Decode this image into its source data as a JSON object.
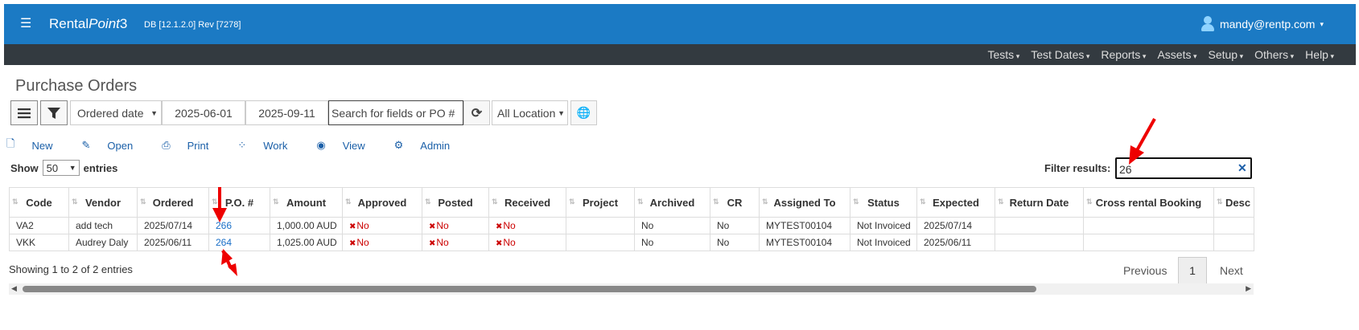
{
  "header": {
    "menu_icon": "hamburger-icon",
    "brand_plain": "Rental",
    "brand_italic": "Point",
    "brand_suffix": "3",
    "version": "DB [12.1.2.0]  Rev [7278]",
    "user": "mandy@rentp.com",
    "accent": "#1b7ac4"
  },
  "nav": {
    "items": [
      "Tests",
      "Test Dates",
      "Reports",
      "Assets",
      "Setup",
      "Others",
      "Help"
    ]
  },
  "page": {
    "title": "Purchase Orders"
  },
  "toolbar": {
    "date_field": "Ordered date",
    "from": "2025-06-01",
    "to": "2025-09-11",
    "search_placeholder": "Search for fields or PO #",
    "location": "All Location"
  },
  "actions": {
    "new": "New",
    "open": "Open",
    "print": "Print",
    "work": "Work",
    "view": "View",
    "admin": "Admin"
  },
  "entries": {
    "show": "Show",
    "count": "50",
    "suffix": "entries"
  },
  "filter": {
    "label": "Filter results:",
    "value": "26"
  },
  "table": {
    "columns": [
      "Code",
      "Vendor",
      "Ordered",
      "P.O. #",
      "Amount",
      "Approved",
      "Posted",
      "Received",
      "Project",
      "Archived",
      "CR",
      "Assigned To",
      "Status",
      "Expected",
      "Return Date",
      "Cross rental Booking",
      "Desc"
    ],
    "rows": [
      [
        "VA2",
        "add tech",
        "2025/07/14",
        "266",
        "1,000.00 AUD",
        "No",
        "No",
        "No",
        "",
        "No",
        "No",
        "MYTEST00104",
        "Not Invoiced",
        "2025/07/14",
        "",
        "",
        ""
      ],
      [
        "VKK",
        "Audrey Daly",
        "2025/06/11",
        "264",
        "1,025.00 AUD",
        "No",
        "No",
        "No",
        "",
        "No",
        "No",
        "MYTEST00104",
        "Not Invoiced",
        "2025/06/11",
        "",
        "",
        ""
      ]
    ]
  },
  "footer": {
    "info": "Showing 1 to 2 of 2 entries",
    "previous": "Previous",
    "page": "1",
    "next": "Next"
  }
}
